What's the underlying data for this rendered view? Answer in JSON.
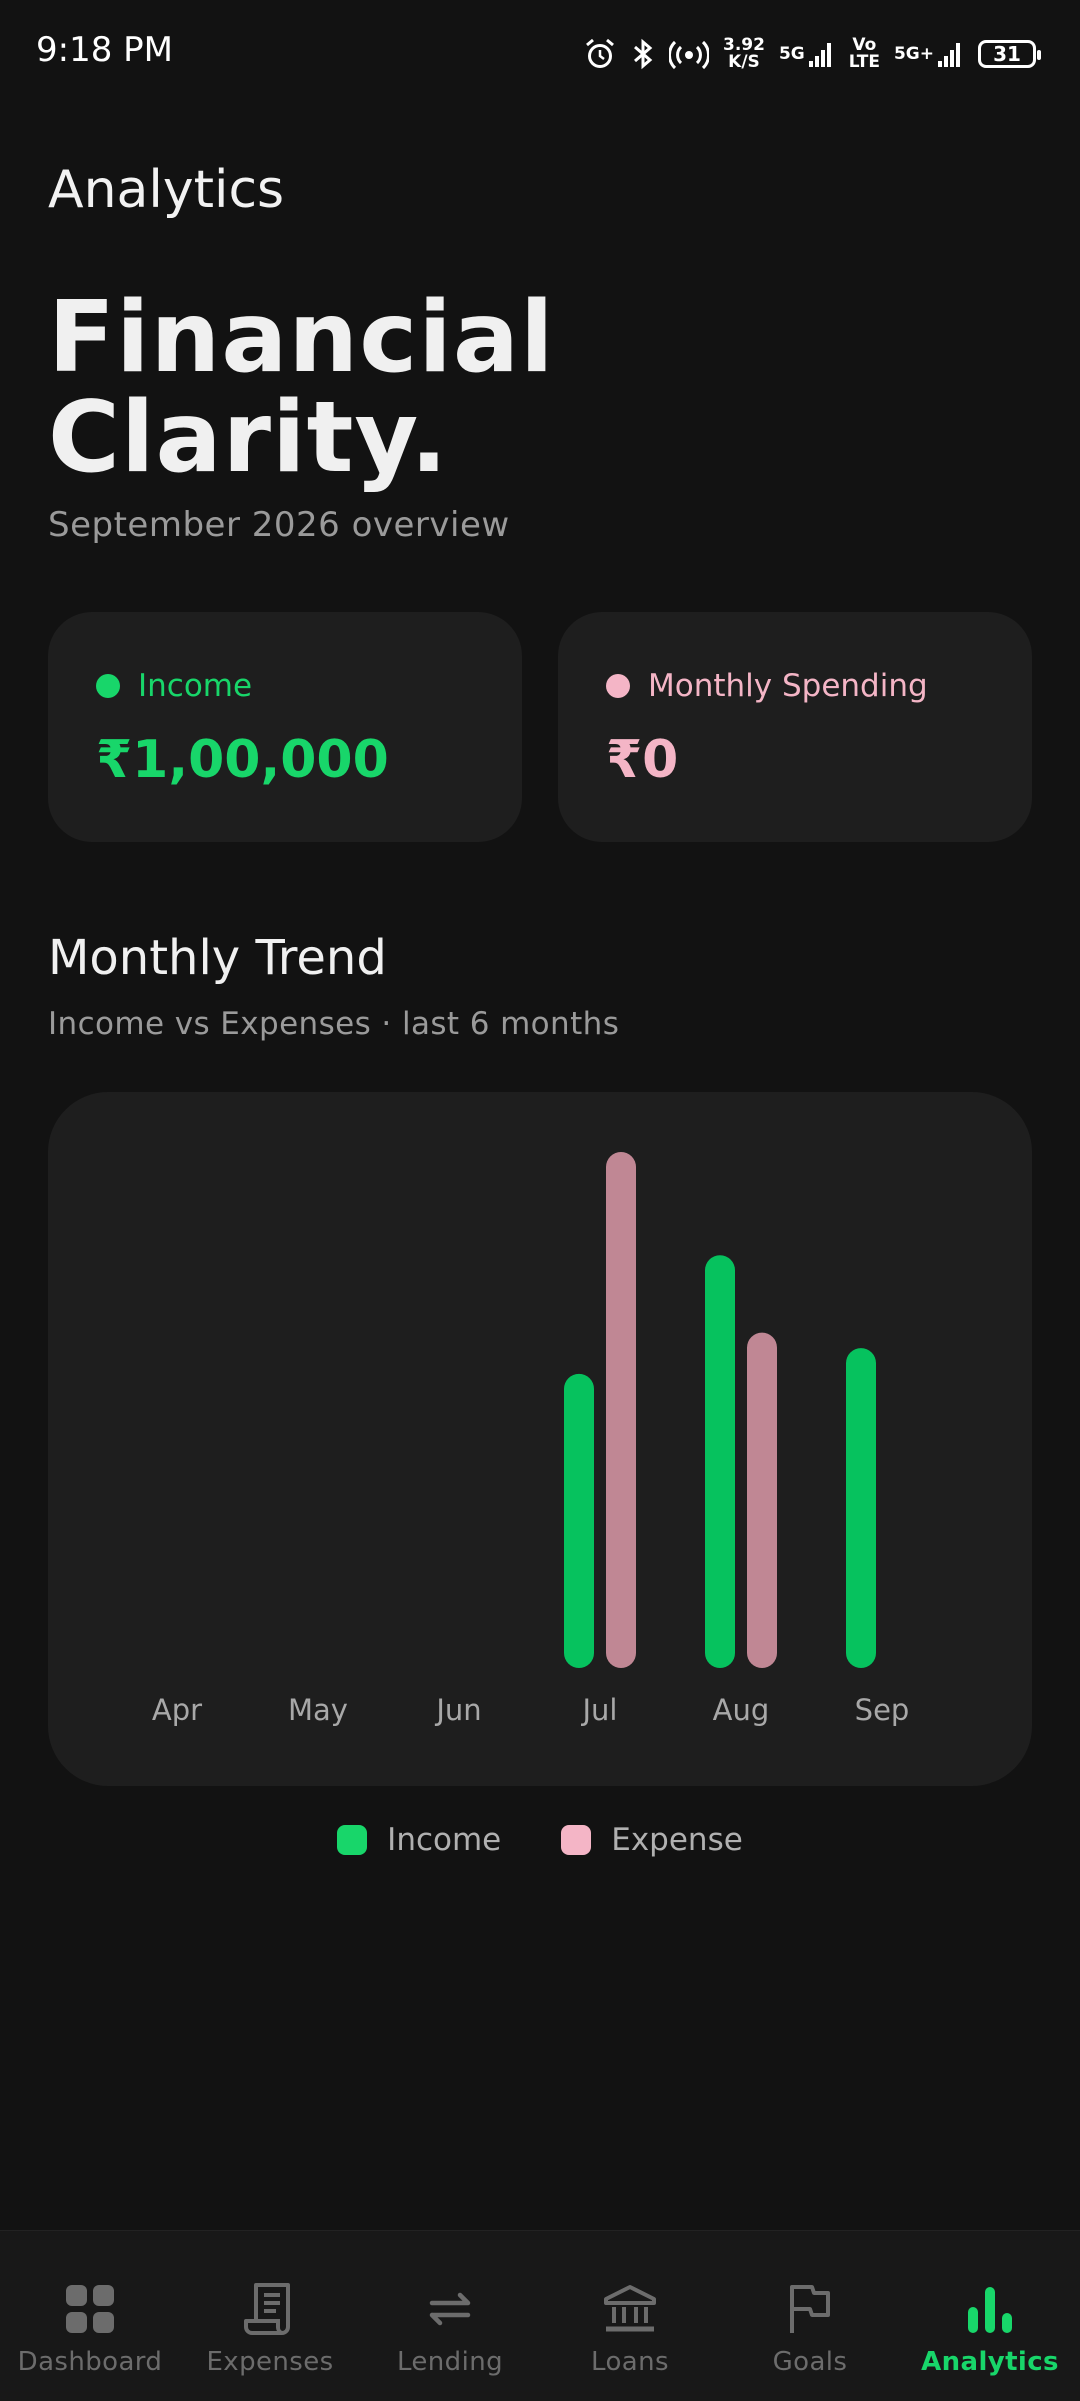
{
  "status_bar": {
    "time": "9:18 PM",
    "net_speed_value": "3.92",
    "net_speed_unit": "K/S",
    "sim1": "5G",
    "sim1_volte_top": "Vo",
    "sim1_volte_bottom": "LTE",
    "sim2": "5G+",
    "battery": "31"
  },
  "header": {
    "app_title": "Analytics",
    "hero_line1": "Financial",
    "hero_line2": "Clarity.",
    "subtitle": "September 2026 overview"
  },
  "cards": {
    "income": {
      "label": "Income",
      "value": "₹1,00,000",
      "color": "#18d66a"
    },
    "spending": {
      "label": "Monthly Spending",
      "value": "₹0",
      "color": "#f4b5c6"
    }
  },
  "trend": {
    "title": "Monthly Trend",
    "subtitle": "Income vs Expenses · last 6 months"
  },
  "chart_data": {
    "type": "bar",
    "categories": [
      "Apr",
      "May",
      "Jun",
      "Jul",
      "Aug",
      "Sep"
    ],
    "series": [
      {
        "name": "Income",
        "color": "#06c25e",
        "values": [
          0,
          0,
          0,
          57,
          80,
          62
        ]
      },
      {
        "name": "Expense",
        "color": "#c08794",
        "values": [
          0,
          0,
          0,
          100,
          65,
          0
        ]
      }
    ],
    "ylim": [
      0,
      100
    ],
    "grid": false,
    "legend_position": "bottom-center"
  },
  "legend": {
    "income_label": "Income",
    "income_color": "#18d66a",
    "expense_label": "Expense",
    "expense_color": "#f4b5c6"
  },
  "bottom_nav": {
    "items": [
      {
        "label": "Dashboard",
        "icon": "grid-icon"
      },
      {
        "label": "Expenses",
        "icon": "receipt-icon"
      },
      {
        "label": "Lending",
        "icon": "swap-arrows-icon"
      },
      {
        "label": "Loans",
        "icon": "bank-icon"
      },
      {
        "label": "Goals",
        "icon": "flag-icon"
      },
      {
        "label": "Analytics",
        "icon": "bar-chart-icon",
        "active": true
      }
    ]
  }
}
